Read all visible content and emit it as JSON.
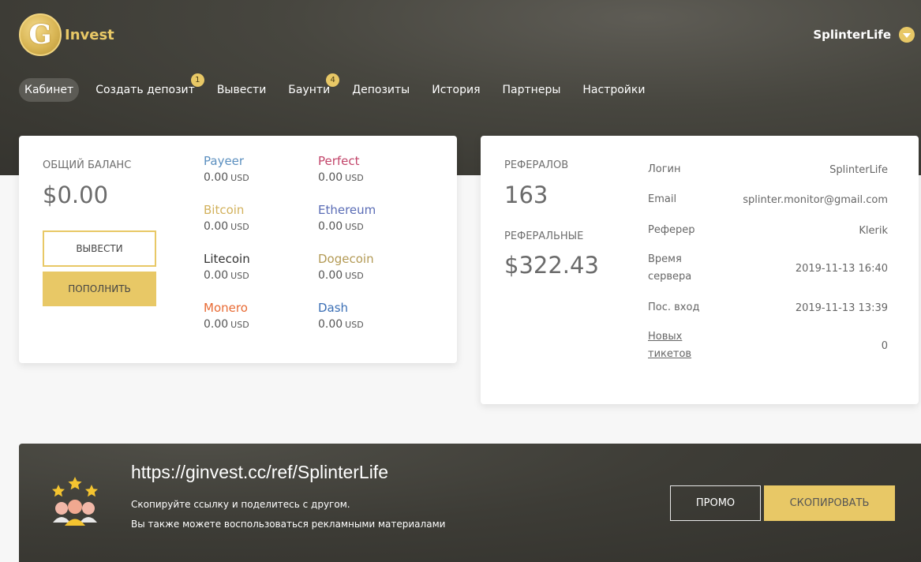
{
  "brand": {
    "logo_letter": "G",
    "name": "Invest"
  },
  "user": {
    "name": "SplinterLife"
  },
  "nav": [
    {
      "label": "Кабинет",
      "active": true
    },
    {
      "label": "Создать депозит",
      "badge": "1"
    },
    {
      "label": "Вывести"
    },
    {
      "label": "Баунти",
      "badge": "4"
    },
    {
      "label": "Депозиты"
    },
    {
      "label": "История"
    },
    {
      "label": "Партнеры"
    },
    {
      "label": "Настройки"
    }
  ],
  "balance": {
    "title": "Общий баланс",
    "total": "$0.00",
    "withdraw_label": "Вывести",
    "deposit_label": "Пополнить",
    "wallets": [
      {
        "name": "Payeer",
        "amount": "0.00",
        "currency": "USD",
        "color": "#5b8fbf"
      },
      {
        "name": "Perfect",
        "amount": "0.00",
        "currency": "USD",
        "color": "#c2456a"
      },
      {
        "name": "Bitcoin",
        "amount": "0.00",
        "currency": "USD",
        "color": "#d2b15c"
      },
      {
        "name": "Ethereum",
        "amount": "0.00",
        "currency": "USD",
        "color": "#5a6cb5"
      },
      {
        "name": "Litecoin",
        "amount": "0.00",
        "currency": "USD",
        "color": "#333333"
      },
      {
        "name": "Dogecoin",
        "amount": "0.00",
        "currency": "USD",
        "color": "#b39a55"
      },
      {
        "name": "Monero",
        "amount": "0.00",
        "currency": "USD",
        "color": "#e86a33"
      },
      {
        "name": "Dash",
        "amount": "0.00",
        "currency": "USD",
        "color": "#3b6fb5"
      }
    ]
  },
  "referrals": {
    "count_title": "Рефералов",
    "count": "163",
    "earn_title": "Реферальные",
    "earn": "$322.43",
    "info": [
      {
        "key": "Логин",
        "value": "SplinterLife"
      },
      {
        "key": "Email",
        "value": "splinter.monitor@gmail.com"
      },
      {
        "key": "Реферер",
        "value": "Klerik"
      },
      {
        "key": "Время сервера",
        "value": "2019-11-13 16:40"
      },
      {
        "key": "Пос. вход",
        "value": "2019-11-13 13:39"
      },
      {
        "key": "Новых тикетов",
        "value": "0",
        "link": true
      }
    ]
  },
  "ref_link": {
    "url": "https://ginvest.cc/ref/SplinterLife",
    "desc1": "Скопируйте ссылку и поделитесь с другом.",
    "desc2": "Вы также можете воспользоваться рекламными материалами",
    "promo_label": "Промо",
    "copy_label": "Скопировать"
  },
  "colors": {
    "accent": "#e8c866",
    "hero_dark": "#3d3c36"
  }
}
